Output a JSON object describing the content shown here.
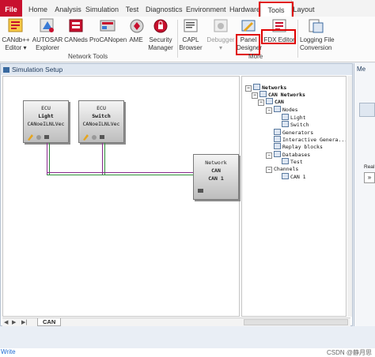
{
  "ribbon_tabs": [
    "File",
    "Home",
    "Analysis",
    "Simulation",
    "Test",
    "Diagnostics",
    "Environment",
    "Hardware",
    "Tools",
    "Layout"
  ],
  "ribbon_buttons": {
    "candb": "CANdb++\nEditor ▾",
    "autosar": "AUTOSAR\nExplorer",
    "caneds": "CANeds",
    "procanopen": "ProCANopen",
    "ame": "AME",
    "security": "Security\nManager",
    "capl": "CAPL\nBrowser",
    "debugger": "Debugger\n▾",
    "panel": "Panel\nDesigner",
    "fdx": "FDX Editor",
    "logging": "Logging File\nConversion"
  },
  "ribbon_groups": {
    "network_tools": "Network Tools",
    "more": "More"
  },
  "sim_window": {
    "title": "Simulation Setup"
  },
  "nodes": [
    {
      "line1": "ECU",
      "line2": "Light",
      "line3": "CANoeILNLVec"
    },
    {
      "line1": "ECU",
      "line2": "Switch",
      "line3": "CANoeILNLVec"
    }
  ],
  "network_node": {
    "line1": "Network",
    "line2": "CAN",
    "line3": "CAN 1"
  },
  "tree": [
    {
      "label": "Networks",
      "bold": true
    },
    {
      "label": "CAN Networks",
      "bold": true
    },
    {
      "label": "CAN",
      "bold": true
    },
    {
      "label": "Nodes"
    },
    {
      "label": "Light"
    },
    {
      "label": "Switch"
    },
    {
      "label": "Generators"
    },
    {
      "label": "Interactive Genera..."
    },
    {
      "label": "Replay blocks"
    },
    {
      "label": "Databases"
    },
    {
      "label": "Test"
    },
    {
      "label": "Channels"
    },
    {
      "label": "CAN 1"
    }
  ],
  "bottom_tab": "CAN",
  "right_panel": {
    "label1": "Me",
    "label2": "Real"
  },
  "status": {
    "left": "Write",
    "watermark": "CSDN @静月思"
  },
  "colors": {
    "file_tab": "#c8102e",
    "highlight": "#e00000",
    "bus_purple": "#8b2a8f",
    "bus_green": "#2f8f3a"
  }
}
